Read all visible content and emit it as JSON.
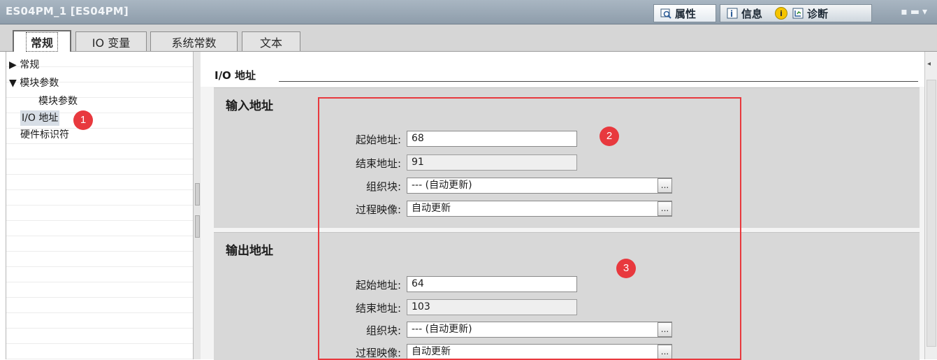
{
  "window": {
    "title": "ES04PM_1 [ES04PM]",
    "inspector_tabs": [
      {
        "label": "属性",
        "icon": "properties-icon",
        "active": true
      },
      {
        "label": "信息",
        "icon": "info-icon",
        "active": false
      },
      {
        "label": "诊断",
        "icon": "diagnostics-icon",
        "active": false
      }
    ],
    "window_controls": "▭ ▭"
  },
  "tabs": [
    {
      "label": "常规",
      "active": true
    },
    {
      "label": "IO 变量",
      "active": false
    },
    {
      "label": "系统常数",
      "active": false
    },
    {
      "label": "文本",
      "active": false
    }
  ],
  "nav": {
    "items": [
      {
        "label": "▶ 常规",
        "level": 0
      },
      {
        "label": "▼ 模块参数",
        "level": 0
      },
      {
        "label": "模块参数",
        "level": 1
      },
      {
        "label": "I/O 地址",
        "level": 0,
        "selected": true
      },
      {
        "label": "硬件标识符",
        "level": 0
      }
    ]
  },
  "section": {
    "title": "I/O 地址"
  },
  "input_address": {
    "title": "输入地址",
    "start_label": "起始地址:",
    "start_value": "68",
    "end_label": "结束地址:",
    "end_value": "91",
    "ob_label": "组织块:",
    "ob_value": "--- (自动更新)",
    "pi_label": "过程映像:",
    "pi_value": "自动更新"
  },
  "output_address": {
    "title": "输出地址",
    "start_label": "起始地址:",
    "start_value": "64",
    "end_label": "结束地址:",
    "end_value": "103",
    "ob_label": "组织块:",
    "ob_value": "--- (自动更新)",
    "pi_label": "过程映像:",
    "pi_value": "自动更新"
  },
  "browse_label": "...",
  "annotations": [
    "1",
    "2",
    "3"
  ],
  "colors": {
    "highlight": "#e8393e",
    "header": "#97a6b4"
  }
}
